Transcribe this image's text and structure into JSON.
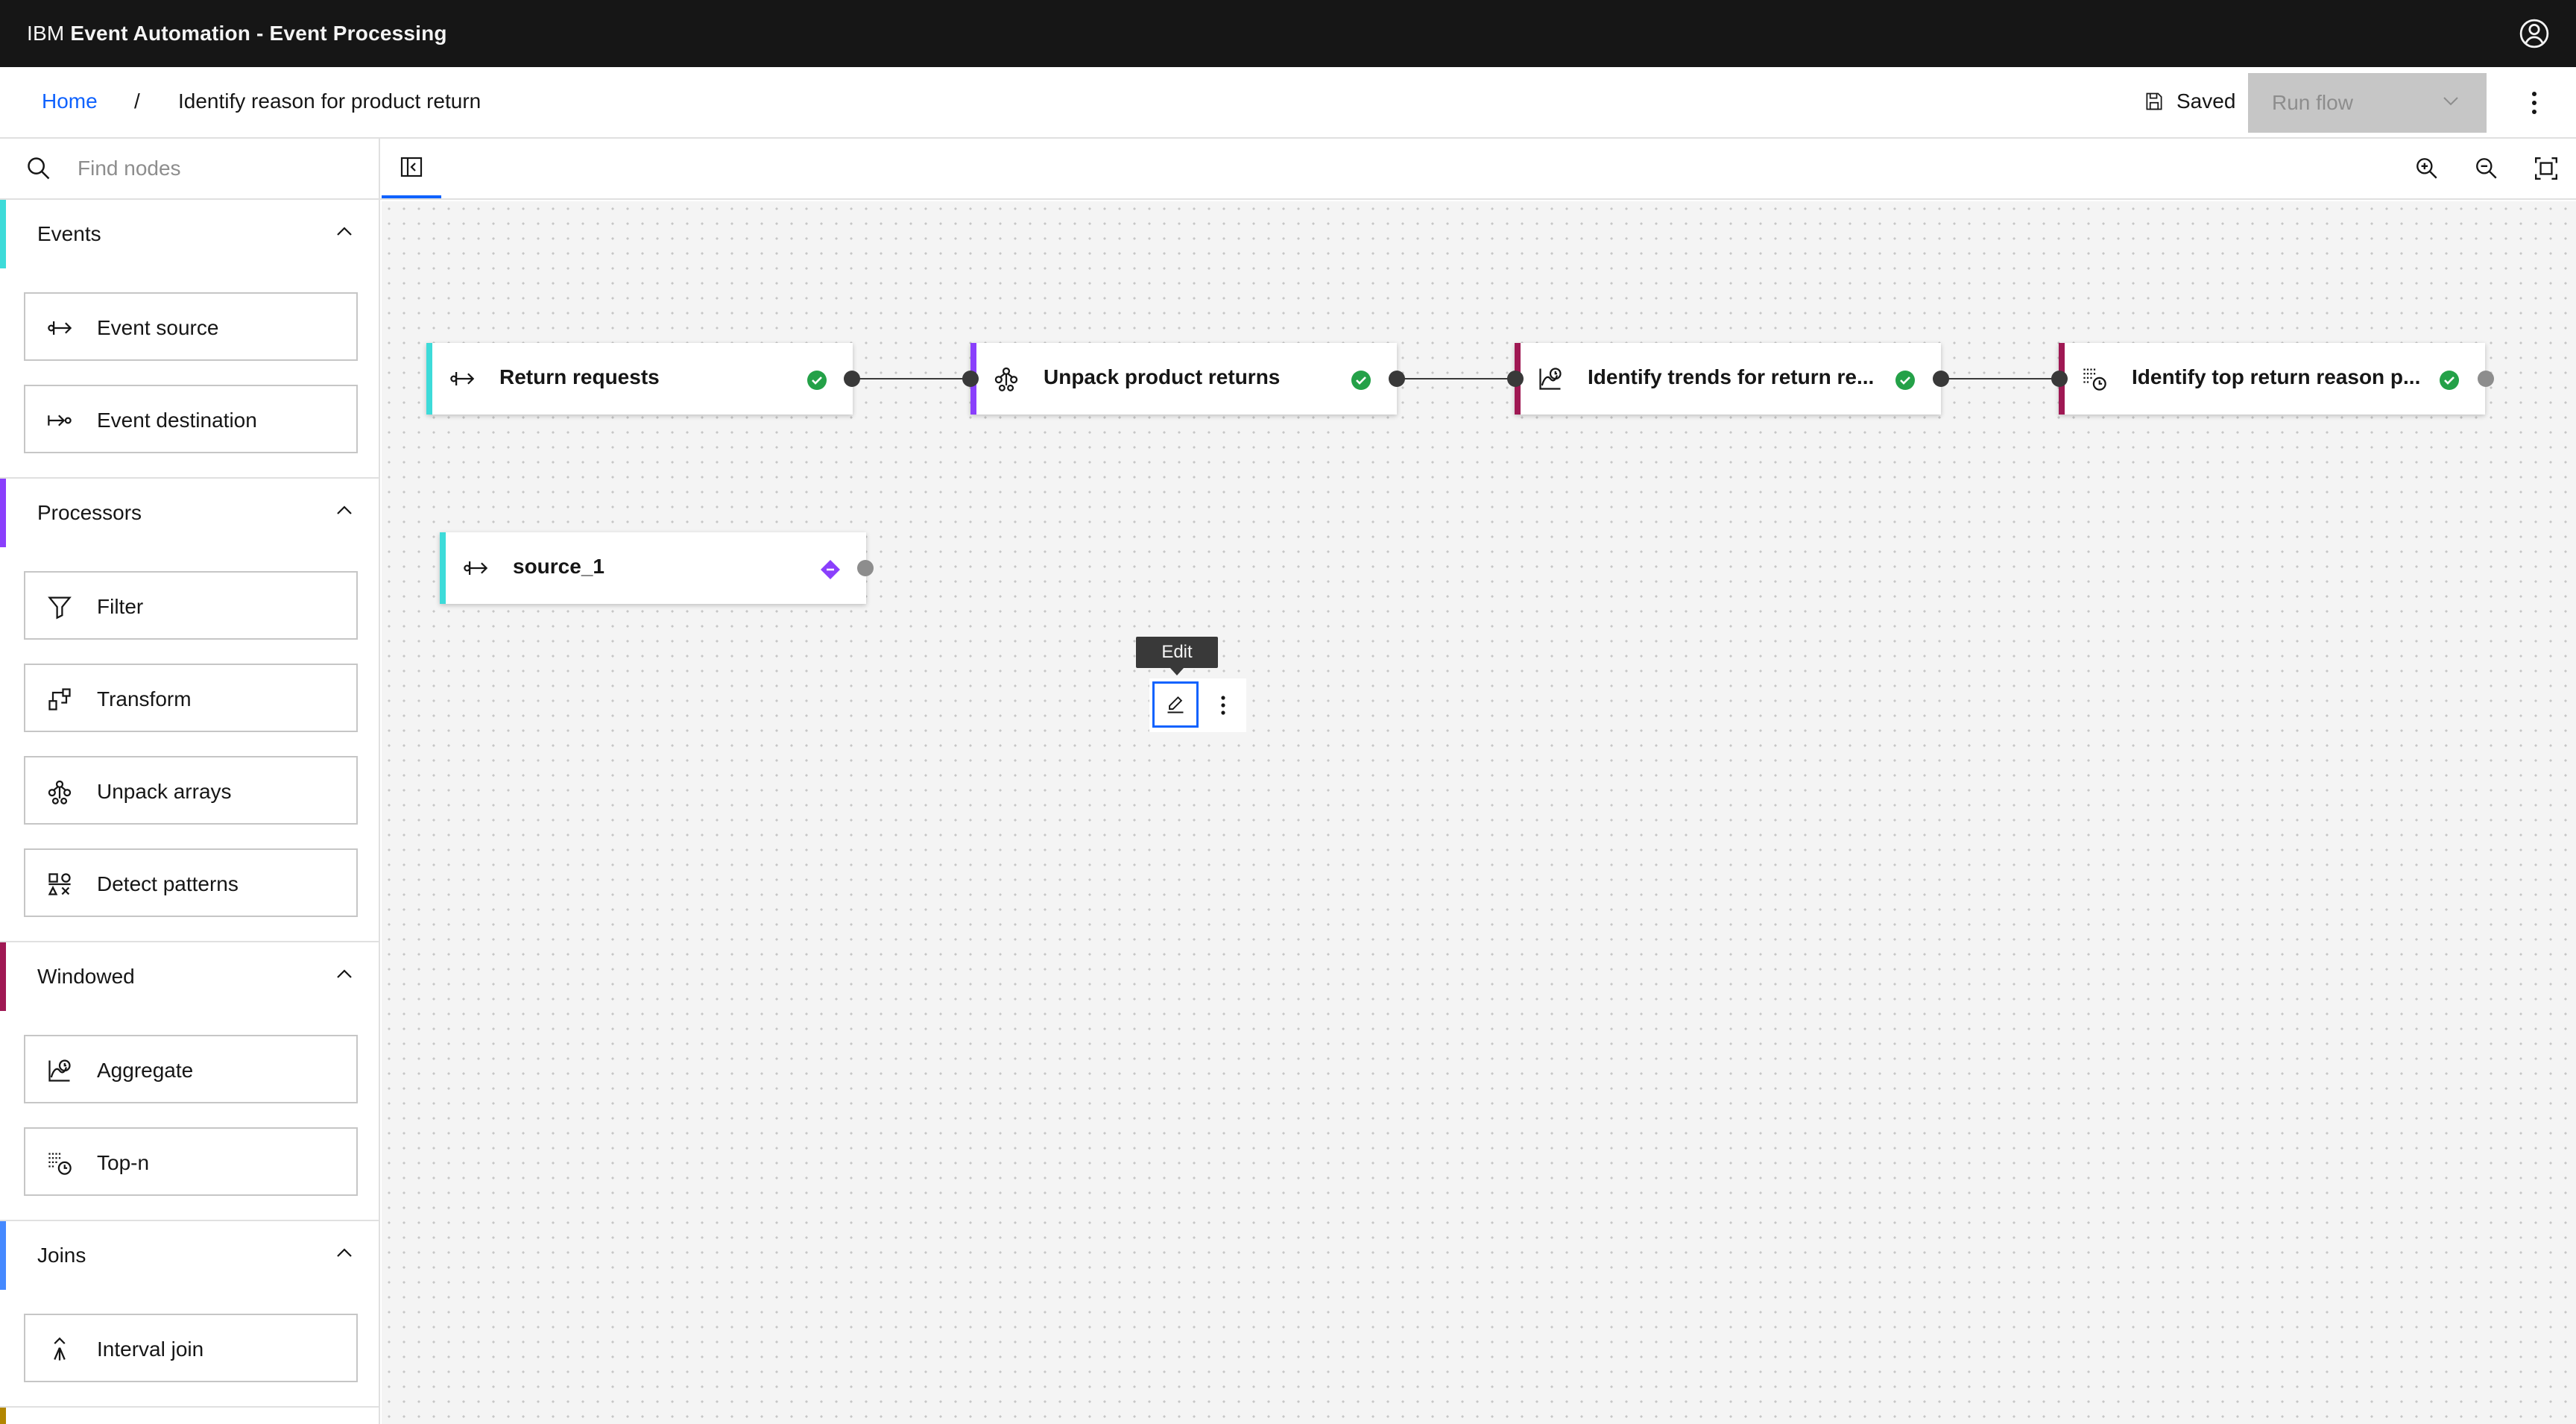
{
  "header": {
    "brand_prefix": "IBM ",
    "brand_product": "Event Automation - Event Processing",
    "user_icon": "user-avatar-icon"
  },
  "breadcrumb": {
    "home": "Home",
    "separator": "/",
    "current": "Identify reason for product return"
  },
  "actions": {
    "saved_label": "Saved",
    "run_flow_label": "Run flow"
  },
  "toolbar": {
    "search_placeholder": "Find nodes",
    "search_value": ""
  },
  "palette": {
    "sections": [
      {
        "title": "Events",
        "color": "#3ddbd9",
        "items": [
          "Event source",
          "Event destination"
        ]
      },
      {
        "title": "Processors",
        "color": "#8a3ffc",
        "items": [
          "Filter",
          "Transform",
          "Unpack arrays",
          "Detect patterns"
        ]
      },
      {
        "title": "Windowed",
        "color": "#9f1853",
        "items": [
          "Aggregate",
          "Top-n"
        ]
      },
      {
        "title": "Joins",
        "color": "#4589ff",
        "items": [
          "Interval join"
        ]
      }
    ]
  },
  "canvas": {
    "nodes": [
      {
        "label": "Return requests",
        "type": "event-source",
        "status": "valid"
      },
      {
        "label": "Unpack product returns",
        "type": "unpack-arrays",
        "status": "valid"
      },
      {
        "label": "Identify trends for return re...",
        "type": "aggregate",
        "status": "valid"
      },
      {
        "label": "Identify top return reason p...",
        "type": "top-n",
        "status": "valid"
      },
      {
        "label": "source_1",
        "type": "event-source",
        "status": "unconfigured"
      }
    ],
    "tooltip": "Edit"
  },
  "colors": {
    "accent": "#0f62fe",
    "valid": "#24a148",
    "unconfigured": "#8a3ffc"
  }
}
